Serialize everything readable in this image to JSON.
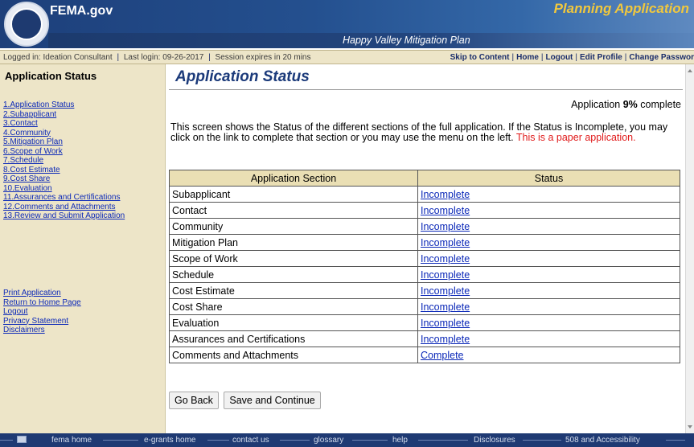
{
  "header": {
    "site_title": "FEMA.gov",
    "app_title": "Planning Application",
    "plan_name": "Happy Valley Mitigation Plan"
  },
  "info_bar": {
    "logged_in": "Logged in: Ideation Consultant",
    "last_login": "Last login: 09-26-2017",
    "session": "Session expires in 20 mins",
    "separator": "|",
    "links": [
      "Skip to Content",
      "Home",
      "Logout",
      "Edit Profile",
      "Change Passwor"
    ]
  },
  "sidebar": {
    "title": "Application Status",
    "nav": [
      "1.Application Status",
      "2.Subapplicant",
      "3.Contact",
      "4.Community",
      "5.Mitigation Plan",
      "6.Scope of Work",
      "7.Schedule",
      "8.Cost Estimate",
      "9.Cost Share",
      "10.Evaluation",
      "11.Assurances and Certifications",
      "12.Comments and Attachments",
      "13.Review and Submit Application"
    ],
    "utility": [
      "Print Application",
      "Return to Home Page",
      "Logout",
      "Privacy Statement",
      "Disclaimers"
    ]
  },
  "main": {
    "title": "Application Status",
    "pct_prefix": "Application ",
    "pct_value": "9%",
    "pct_suffix": " complete",
    "intro": "This screen shows the Status of the different sections of the full application. If the Status is Incomplete, you may click on the link to complete that section or you may use the menu on the left.",
    "paper_note": "This is a paper application.",
    "table": {
      "headers": [
        "Application Section",
        "Status"
      ],
      "rows": [
        {
          "section": "Subapplicant",
          "status": "Incomplete"
        },
        {
          "section": "Contact",
          "status": "Incomplete"
        },
        {
          "section": "Community",
          "status": "Incomplete"
        },
        {
          "section": "Mitigation Plan",
          "status": "Incomplete"
        },
        {
          "section": "Scope of Work",
          "status": "Incomplete"
        },
        {
          "section": "Schedule",
          "status": "Incomplete"
        },
        {
          "section": "Cost Estimate",
          "status": "Incomplete"
        },
        {
          "section": "Cost Share",
          "status": "Incomplete"
        },
        {
          "section": "Evaluation",
          "status": "Incomplete"
        },
        {
          "section": "Assurances and Certifications",
          "status": "Incomplete"
        },
        {
          "section": "Comments and Attachments",
          "status": "Complete"
        }
      ]
    },
    "buttons": {
      "back": "Go Back",
      "save": "Save and Continue"
    }
  },
  "footer": {
    "links": [
      "fema home",
      "e-grants home",
      "contact us",
      "glossary",
      "help",
      "Disclosures",
      "508 and Accessibility"
    ]
  },
  "colors": {
    "header_blue": "#1d3f7a",
    "app_title_gold": "#f1c83d",
    "sidebar_bg": "#ede5c8",
    "link_blue": "#0b28b8",
    "page_title_blue": "#1b3a7a",
    "paper_note_red": "#e01a1a",
    "footer_blue": "#1f3a73"
  },
  "icons": {
    "seal": "dhs-seal-icon",
    "footer": "footer-window-icon"
  }
}
